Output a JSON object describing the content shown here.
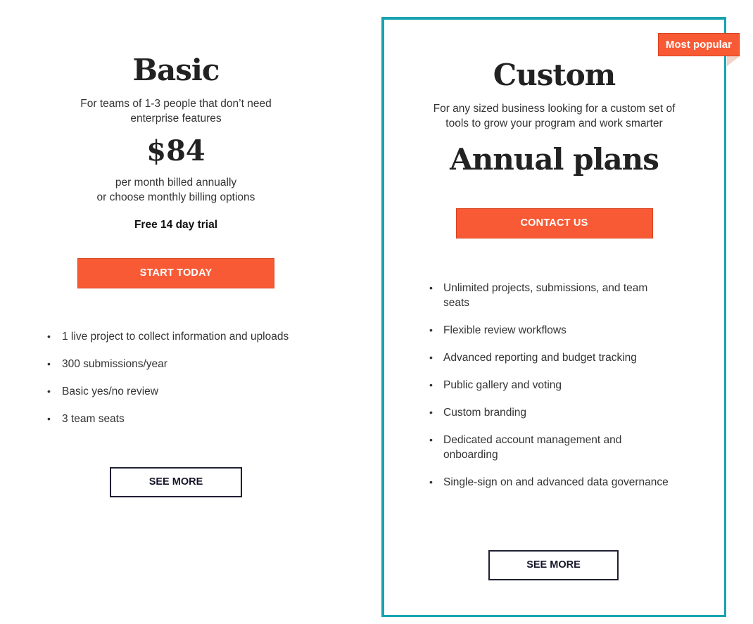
{
  "basic": {
    "title": "Basic",
    "description_line1": "For teams of 1-3 people that don’t need",
    "description_line2": "enterprise features",
    "price": "$84",
    "billing_line1": "per month billed annually",
    "billing_line2": "or choose monthly billing options",
    "trial": "Free 14 day trial",
    "cta_label": "START TODAY",
    "features": [
      "1 live project to collect information and uploads",
      "300 submissions/year",
      "Basic yes/no review",
      "3 team seats"
    ],
    "see_more_label": "SEE MORE"
  },
  "custom": {
    "badge": "Most popular",
    "title": "Custom",
    "description_line1": "For any sized business looking for a custom set of",
    "description_line2": "tools to grow your program and work smarter",
    "annual": "Annual plans",
    "cta_label": "CONTACT US",
    "features": [
      "Unlimited projects, submissions, and team seats",
      "Flexible review workflows",
      "Advanced reporting and budget tracking",
      "Public gallery and voting",
      "Custom branding",
      "Dedicated account management and onboarding",
      "Single-sign on and advanced data governance"
    ],
    "see_more_label": "SEE MORE"
  },
  "colors": {
    "accent": "#f85a35",
    "highlight_border": "#17a3b0",
    "outline_button": "#1f2033"
  },
  "bullet": "•"
}
